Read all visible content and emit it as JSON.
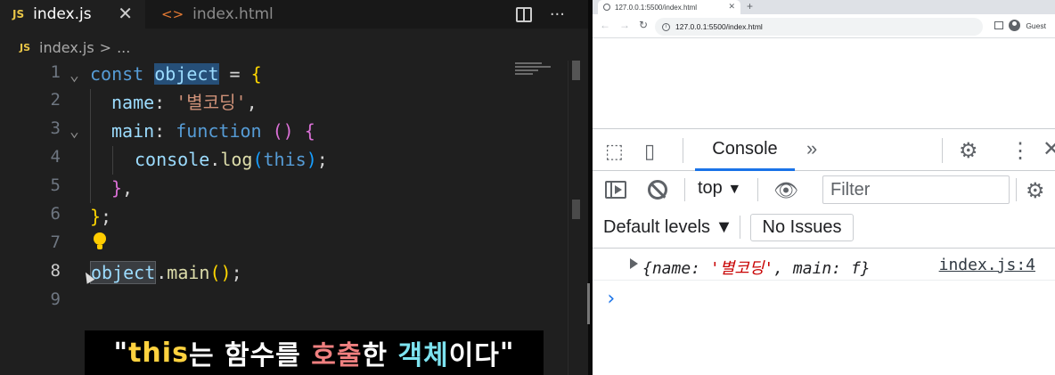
{
  "editor": {
    "tabs": [
      {
        "badge": "JS",
        "label": "index.js",
        "close": "✕"
      },
      {
        "badge": "<>",
        "label": "index.html"
      }
    ],
    "more_actions": "···",
    "breadcrumb": {
      "badge": "JS",
      "file": "index.js",
      "sep": ">",
      "rest": "..."
    },
    "line_numbers": [
      "1",
      "2",
      "3",
      "4",
      "5",
      "6",
      "7",
      "8",
      "9"
    ],
    "code": {
      "l1": {
        "kw": "const",
        "name": "object",
        "eq": " = ",
        "brace": "{"
      },
      "l2": {
        "prop": "name",
        "colon": ": ",
        "str": "'별코딩'",
        "comma": ","
      },
      "l3": {
        "prop": "main",
        "colon": ": ",
        "kw": "function",
        "parens": " ()",
        "brace": " {"
      },
      "l4": {
        "obj": "console",
        "dot": ".",
        "fn": "log",
        "open": "(",
        "kw": "this",
        "close": ")",
        "semi": ";"
      },
      "l5": {
        "brace": "}",
        "comma": ","
      },
      "l6": {
        "brace": "}",
        "semi": ";"
      },
      "l8": {
        "obj": "object",
        "dot": ".",
        "fn": "main",
        "parens": "()",
        "semi": ";"
      }
    },
    "subtitle": {
      "open_quote": "\"",
      "this_word": "this",
      "part1": "는 함수를 ",
      "call_word": "호출",
      "part2": "한 ",
      "object_word": "객체",
      "part3": "이다",
      "close_quote": "\""
    }
  },
  "browser": {
    "tab_title": "127.0.0.1:5500/index.html",
    "tab_close": "✕",
    "new_tab": "+",
    "url": "127.0.0.1:5500/index.html",
    "profile": "Guest",
    "devtools": {
      "console_tab": "Console",
      "more_tabs": "»",
      "context": "top",
      "filter_placeholder": "Filter",
      "levels": "Default levels ▼",
      "issues": "No Issues",
      "log": {
        "open": "{",
        "key1": "name: ",
        "val1": "'별코딩'",
        "sep": ", ",
        "key2": "main: ",
        "val2": "f",
        "close": "}",
        "source": "index.js:4"
      },
      "prompt": "›"
    }
  }
}
